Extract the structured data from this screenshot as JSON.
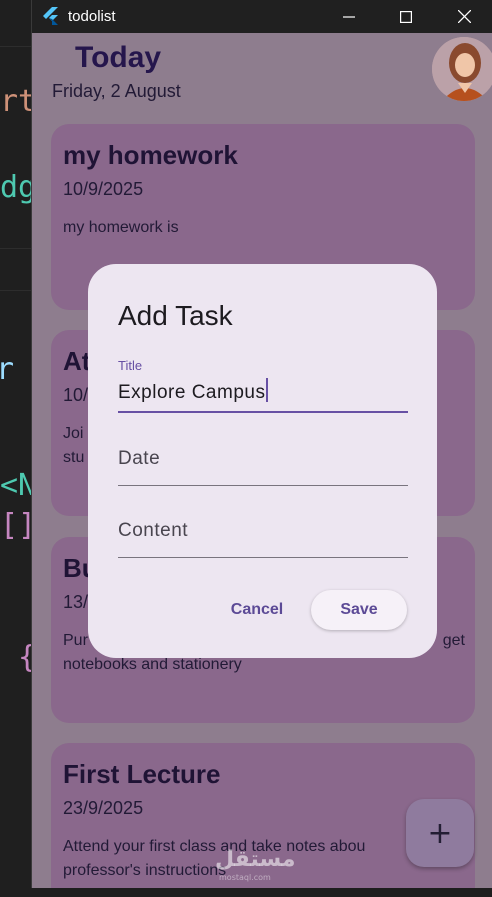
{
  "window": {
    "title": "todolist"
  },
  "header": {
    "title": "Today",
    "date": "Friday, 2 August"
  },
  "tasks": [
    {
      "title": "my homework",
      "date": "10/9/2025",
      "content": "my homework is"
    },
    {
      "title": "At",
      "date": "10/",
      "content": "Joi stu"
    },
    {
      "title": "Bu",
      "date": "13/",
      "content_left": "Pur",
      "content_right": "get",
      "content_2": "notebooks and stationery"
    },
    {
      "title": "First Lecture",
      "date": "23/9/2025",
      "content": "Attend your first class and take notes abou",
      "content_2": "professor's instructions"
    }
  ],
  "dialog": {
    "title": "Add Task",
    "title_field": {
      "label": "Title",
      "value": "Explore Campus"
    },
    "date_field": {
      "label": "Date"
    },
    "content_field": {
      "label": "Content"
    },
    "cancel_label": "Cancel",
    "save_label": "Save"
  },
  "fab": {
    "icon": "plus-icon",
    "label": "+"
  },
  "watermark": {
    "text": "مستقل",
    "sub": "mostaql.com"
  },
  "editor_fragments": [
    "rt'",
    "dge",
    "r _",
    "<N",
    "[]",
    "{"
  ],
  "colors": {
    "scrim_bg": "#8e7d8e",
    "card_bg": "#8a688c",
    "dialog_bg": "#ede6f1",
    "accent": "#6750a4"
  }
}
